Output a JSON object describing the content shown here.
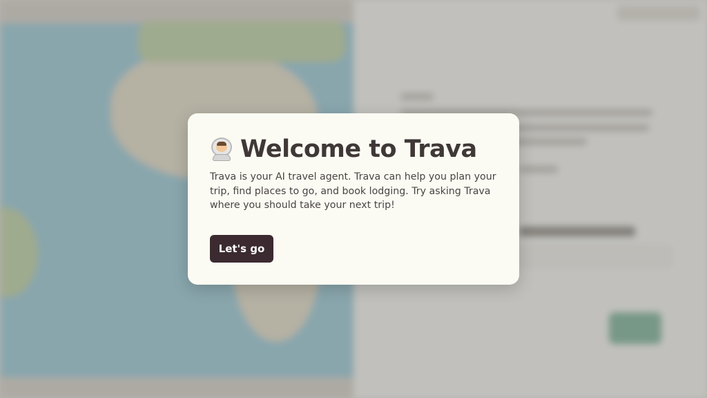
{
  "modal": {
    "title": "Welcome to Trava",
    "icon": "astronaut-icon",
    "body": "Trava is your AI travel agent. Trava can help you plan your trip, find places to go, and book lodging. Try asking Trava where you should take your next trip!",
    "cta_label": "Let's go"
  },
  "colors": {
    "modal_background": "#fcfbf3",
    "title": "#3f3837",
    "button_background": "#3b2b30",
    "button_text": "#ffffff",
    "ocean": "#a9d3de",
    "land": "#e9e3cf",
    "send_button": "#8fbfa5"
  }
}
